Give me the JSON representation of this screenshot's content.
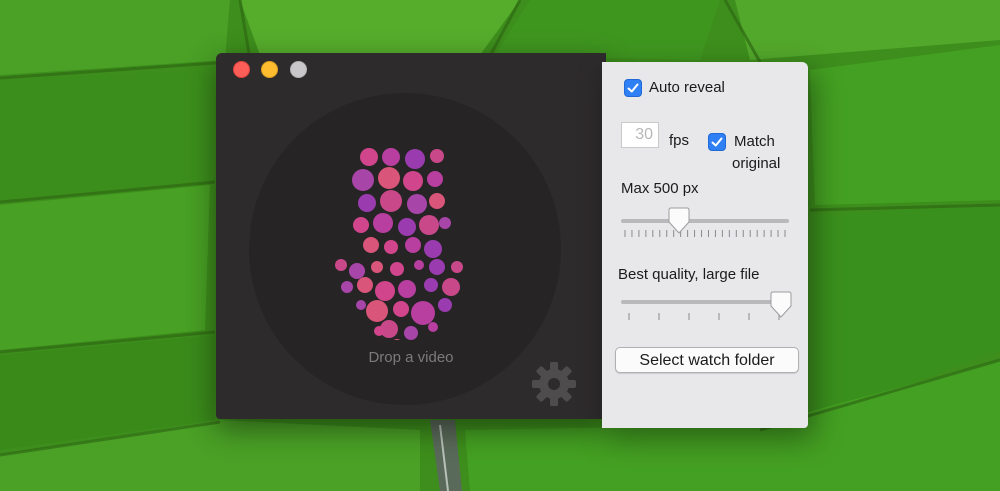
{
  "app": {
    "drop_label": "Drop a video",
    "settings_icon": "gear-icon"
  },
  "settings": {
    "auto_reveal": {
      "label": "Auto reveal",
      "checked": true
    },
    "fps": {
      "value": "30",
      "unit": "fps"
    },
    "match_original": {
      "label_line1": "Match",
      "label_line2": "original",
      "checked": true
    },
    "max_size": {
      "label": "Max 500 px",
      "level": 0.33
    },
    "quality": {
      "label": "Best quality, large file",
      "level": 1.0
    },
    "watch_folder_button": "Select watch folder"
  },
  "colors": {
    "checkbox": "#2f7ff5",
    "window_dark": "#2e2b2c",
    "panel_light": "#e8e7ea",
    "bubble_palette": [
      "#d0458c",
      "#b83ea0",
      "#9a3cb0",
      "#c8488a",
      "#a845a8",
      "#d9557a"
    ]
  }
}
